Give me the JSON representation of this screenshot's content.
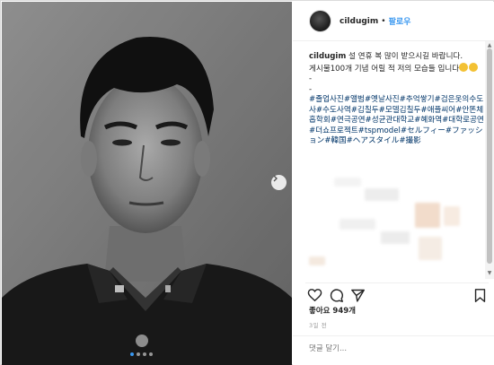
{
  "post": {
    "username": "cildugim",
    "separator": "•",
    "follow_label": "팔로우",
    "caption_lines": [
      "설 연휴 복 많이 받으시길 바랍니다.",
      "게시물100개 기념 어릴 적 저의 모습들 입니다",
      "-",
      "-"
    ],
    "hashtags": "#졸업사진#앨범#옛날사진#추억쌓기#검은옷의수도사#수도사역#김칠두#모델김칠두#애플씨어#안똔체홉학회#연극공연#성균관대학교#혜화역#대학로공연#더쇼프로젝트#tspmodel#セルフィー#ファッション#韓国#ヘアスタイル#撮影",
    "likes": "좋아요 949개",
    "time": "3일 전",
    "comment_placeholder": "댓글 달기..."
  },
  "carousel": {
    "slide_count": 4,
    "active_index": 1
  },
  "colors": {
    "accent": "#3897f0",
    "tag": "#003569",
    "text": "#262626",
    "muted": "#999999"
  },
  "icons": [
    "heart-icon",
    "comment-icon",
    "share-icon",
    "bookmark-icon",
    "chevron-right-icon"
  ]
}
